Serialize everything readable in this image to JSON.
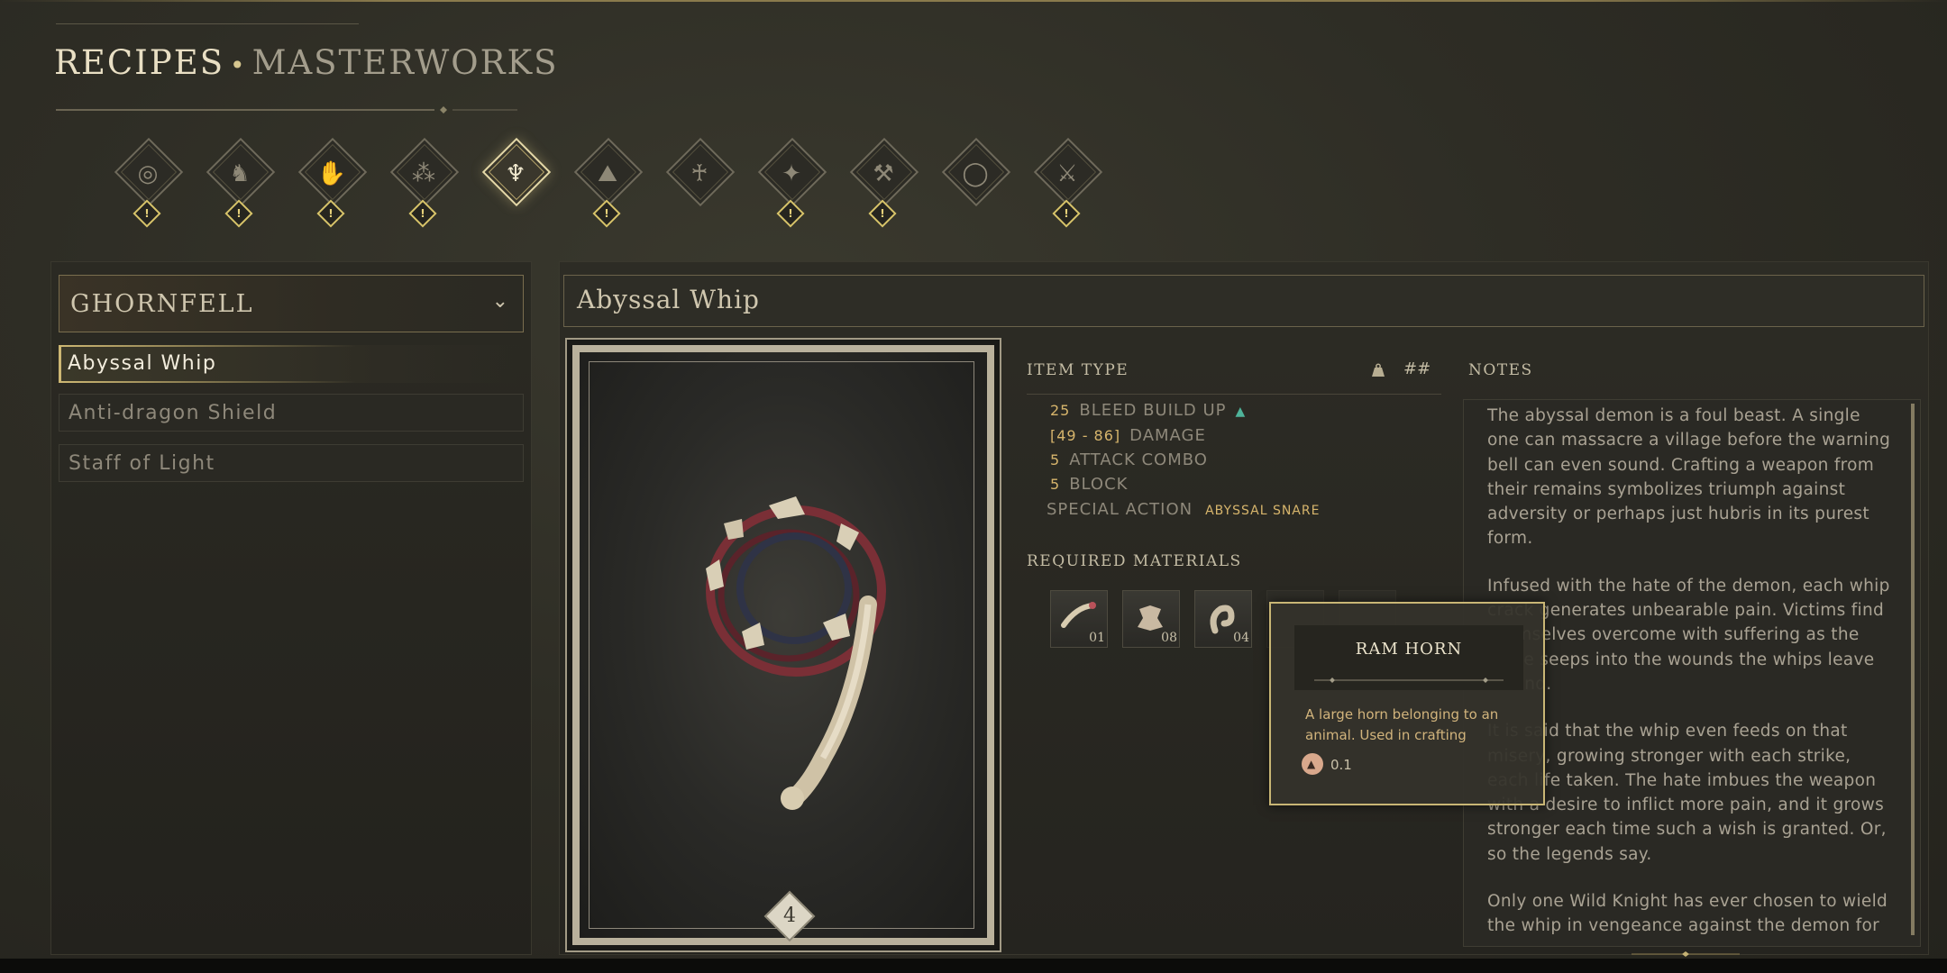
{
  "header": {
    "title_primary": "RECIPES",
    "separator": "•",
    "title_secondary": "MASTERWORKS"
  },
  "categories": [
    {
      "icon": "shield-icon",
      "glyph": "◎",
      "warning": "!",
      "active": false
    },
    {
      "icon": "helmet-icon",
      "glyph": "♞",
      "warning": "!",
      "active": false
    },
    {
      "icon": "gloves-icon",
      "glyph": "✋",
      "warning": "!",
      "active": false
    },
    {
      "icon": "boots-icon",
      "glyph": "⁂",
      "warning": "!",
      "active": false
    },
    {
      "icon": "whip-icon",
      "glyph": "♆",
      "warning": "",
      "active": true
    },
    {
      "icon": "armor-icon",
      "glyph": "⛰",
      "warning": "!",
      "active": false
    },
    {
      "icon": "staff-icon",
      "glyph": "♰",
      "warning": "",
      "active": false
    },
    {
      "icon": "spark-icon",
      "glyph": "✦",
      "warning": "!",
      "active": false
    },
    {
      "icon": "pickaxe-icon",
      "glyph": "⚒",
      "warning": "!",
      "active": false
    },
    {
      "icon": "ring-icon",
      "glyph": "◯",
      "warning": "",
      "active": false
    },
    {
      "icon": "axe-icon",
      "glyph": "⚔",
      "warning": "!",
      "active": false
    }
  ],
  "region": {
    "label": "GHORNFELL",
    "chevron": "⌄"
  },
  "recipes": [
    {
      "label": "Abyssal Whip",
      "selected": true
    },
    {
      "label": "Anti-dragon Shield",
      "selected": false
    },
    {
      "label": "Staff of Light",
      "selected": false
    }
  ],
  "item": {
    "name": "Abyssal Whip",
    "tier": "4",
    "item_type_header": "ITEM TYPE",
    "hash_label": "##",
    "stats": [
      {
        "num": "25",
        "label": "BLEED BUILD UP",
        "up": "▲"
      },
      {
        "num": "[49 - 86]",
        "label": "DAMAGE"
      },
      {
        "num": "5",
        "label": "ATTACK COMBO"
      },
      {
        "num": "5",
        "label": "BLOCK"
      }
    ],
    "special_action_label": "SPECIAL ACTION",
    "special_action_value": "ABYSSAL SNARE",
    "materials_header": "REQUIRED MATERIALS",
    "materials": [
      {
        "icon": "bone-icon",
        "count": "01"
      },
      {
        "icon": "hide-icon",
        "count": "08"
      },
      {
        "icon": "ram-horn-icon",
        "count": "04"
      }
    ]
  },
  "notes": {
    "header": "NOTES",
    "paragraphs": [
      "The abyssal demon is a foul beast. A single one can massacre a village before the warning bell can even sound. Crafting a weapon from their remains symbolizes triumph against adversity or perhaps just hubris in its purest form.",
      "Infused with the hate of the demon, each whip crack generates unbearable pain. Victims find themselves overcome with suffering as the curse seeps into the wounds the whips leave behind.",
      "It is said that the whip even feeds on that misery, growing stronger with each strike, each life taken. The hate imbues the weapon with a desire to inflict more pain, and it grows stronger each time such a wish is granted. Or, so the legends say.",
      "Only one Wild Knight has ever chosen to wield the whip in vengeance against the demon for"
    ]
  },
  "tooltip": {
    "title": "RAM HORN",
    "description": "A large horn belonging to an animal. Used in crafting",
    "weight": "0.1"
  },
  "colors": {
    "accent_gold": "#cdb773",
    "stat_number": "#d7b56c",
    "stat_up": "#4fb39a",
    "warning": "#d8c46a"
  }
}
